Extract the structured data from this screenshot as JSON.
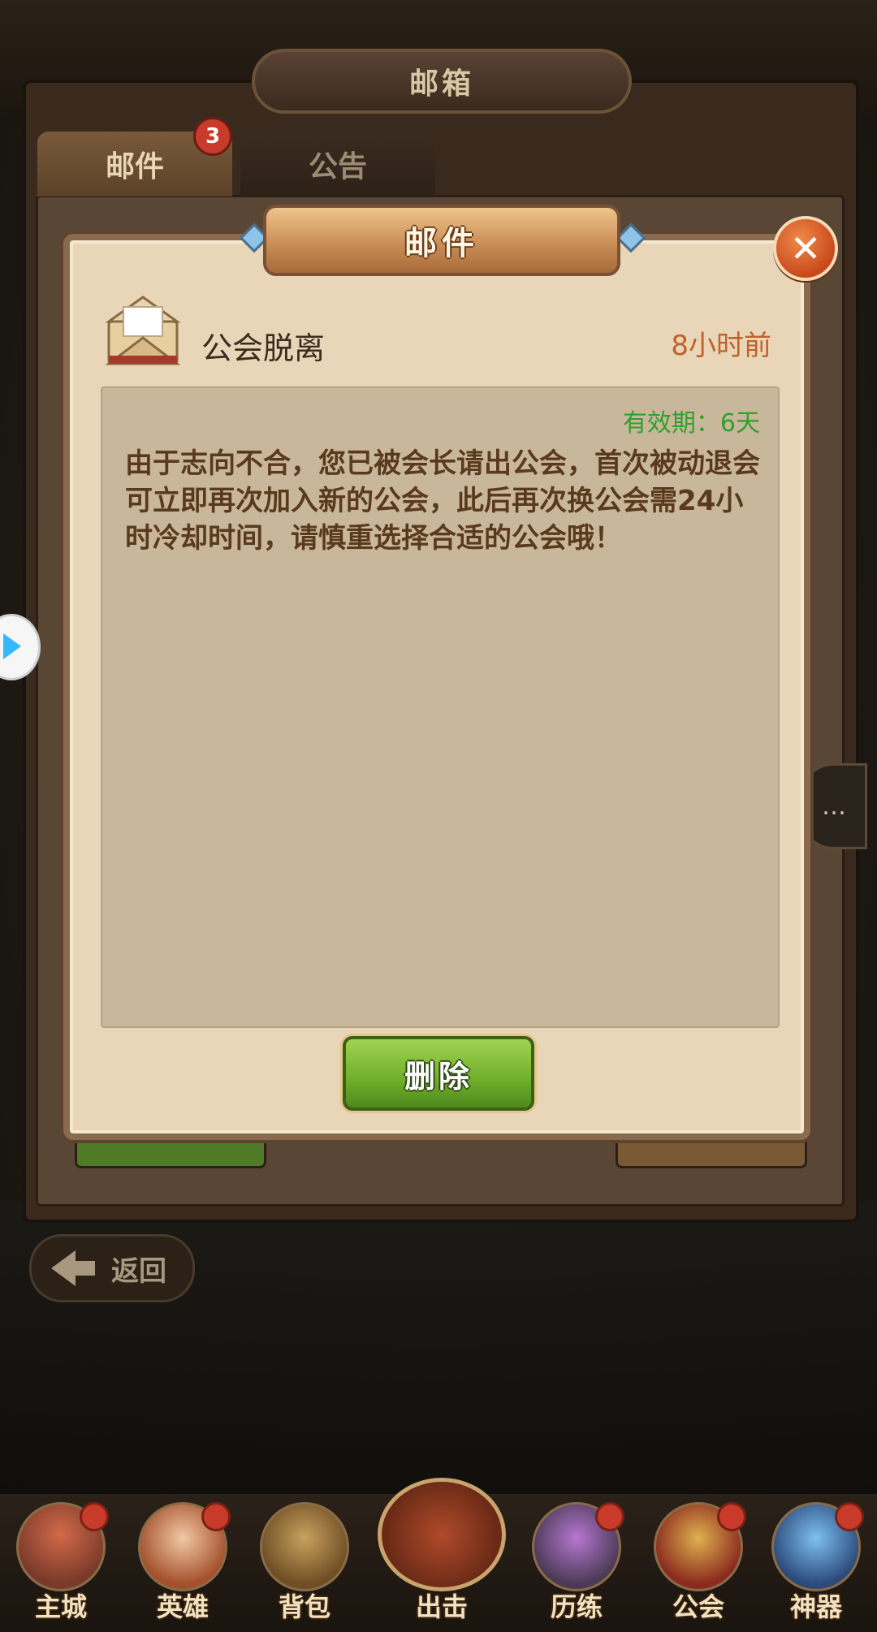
{
  "mailbox": {
    "title": "邮箱",
    "tabs": [
      {
        "label": "邮件",
        "badge": "3"
      },
      {
        "label": "公告"
      }
    ]
  },
  "modal": {
    "title": "邮件",
    "close_icon": "close-icon",
    "mail": {
      "subject": "公会脱离",
      "time_ago": "8小时前",
      "validity_label": "有效期：",
      "validity_value": "6天",
      "body": "由于志向不合，您已被会长请出公会，首次被动退会可立即再次加入新的公会，此后再次换公会需24小时冷却时间，请慎重选择合适的公会哦！"
    },
    "delete_label": "删除"
  },
  "back_button": {
    "label": "返回"
  },
  "side": {
    "chat_icon": "…"
  },
  "nav": {
    "items": [
      {
        "label": "主城"
      },
      {
        "label": "英雄"
      },
      {
        "label": "背包"
      },
      {
        "label": "出击"
      },
      {
        "label": "历练"
      },
      {
        "label": "公会"
      },
      {
        "label": "神器"
      }
    ]
  },
  "colors": {
    "accent_orange": "#c0612a",
    "validity_green": "#2ea12a",
    "button_green": "#6fae2b"
  }
}
